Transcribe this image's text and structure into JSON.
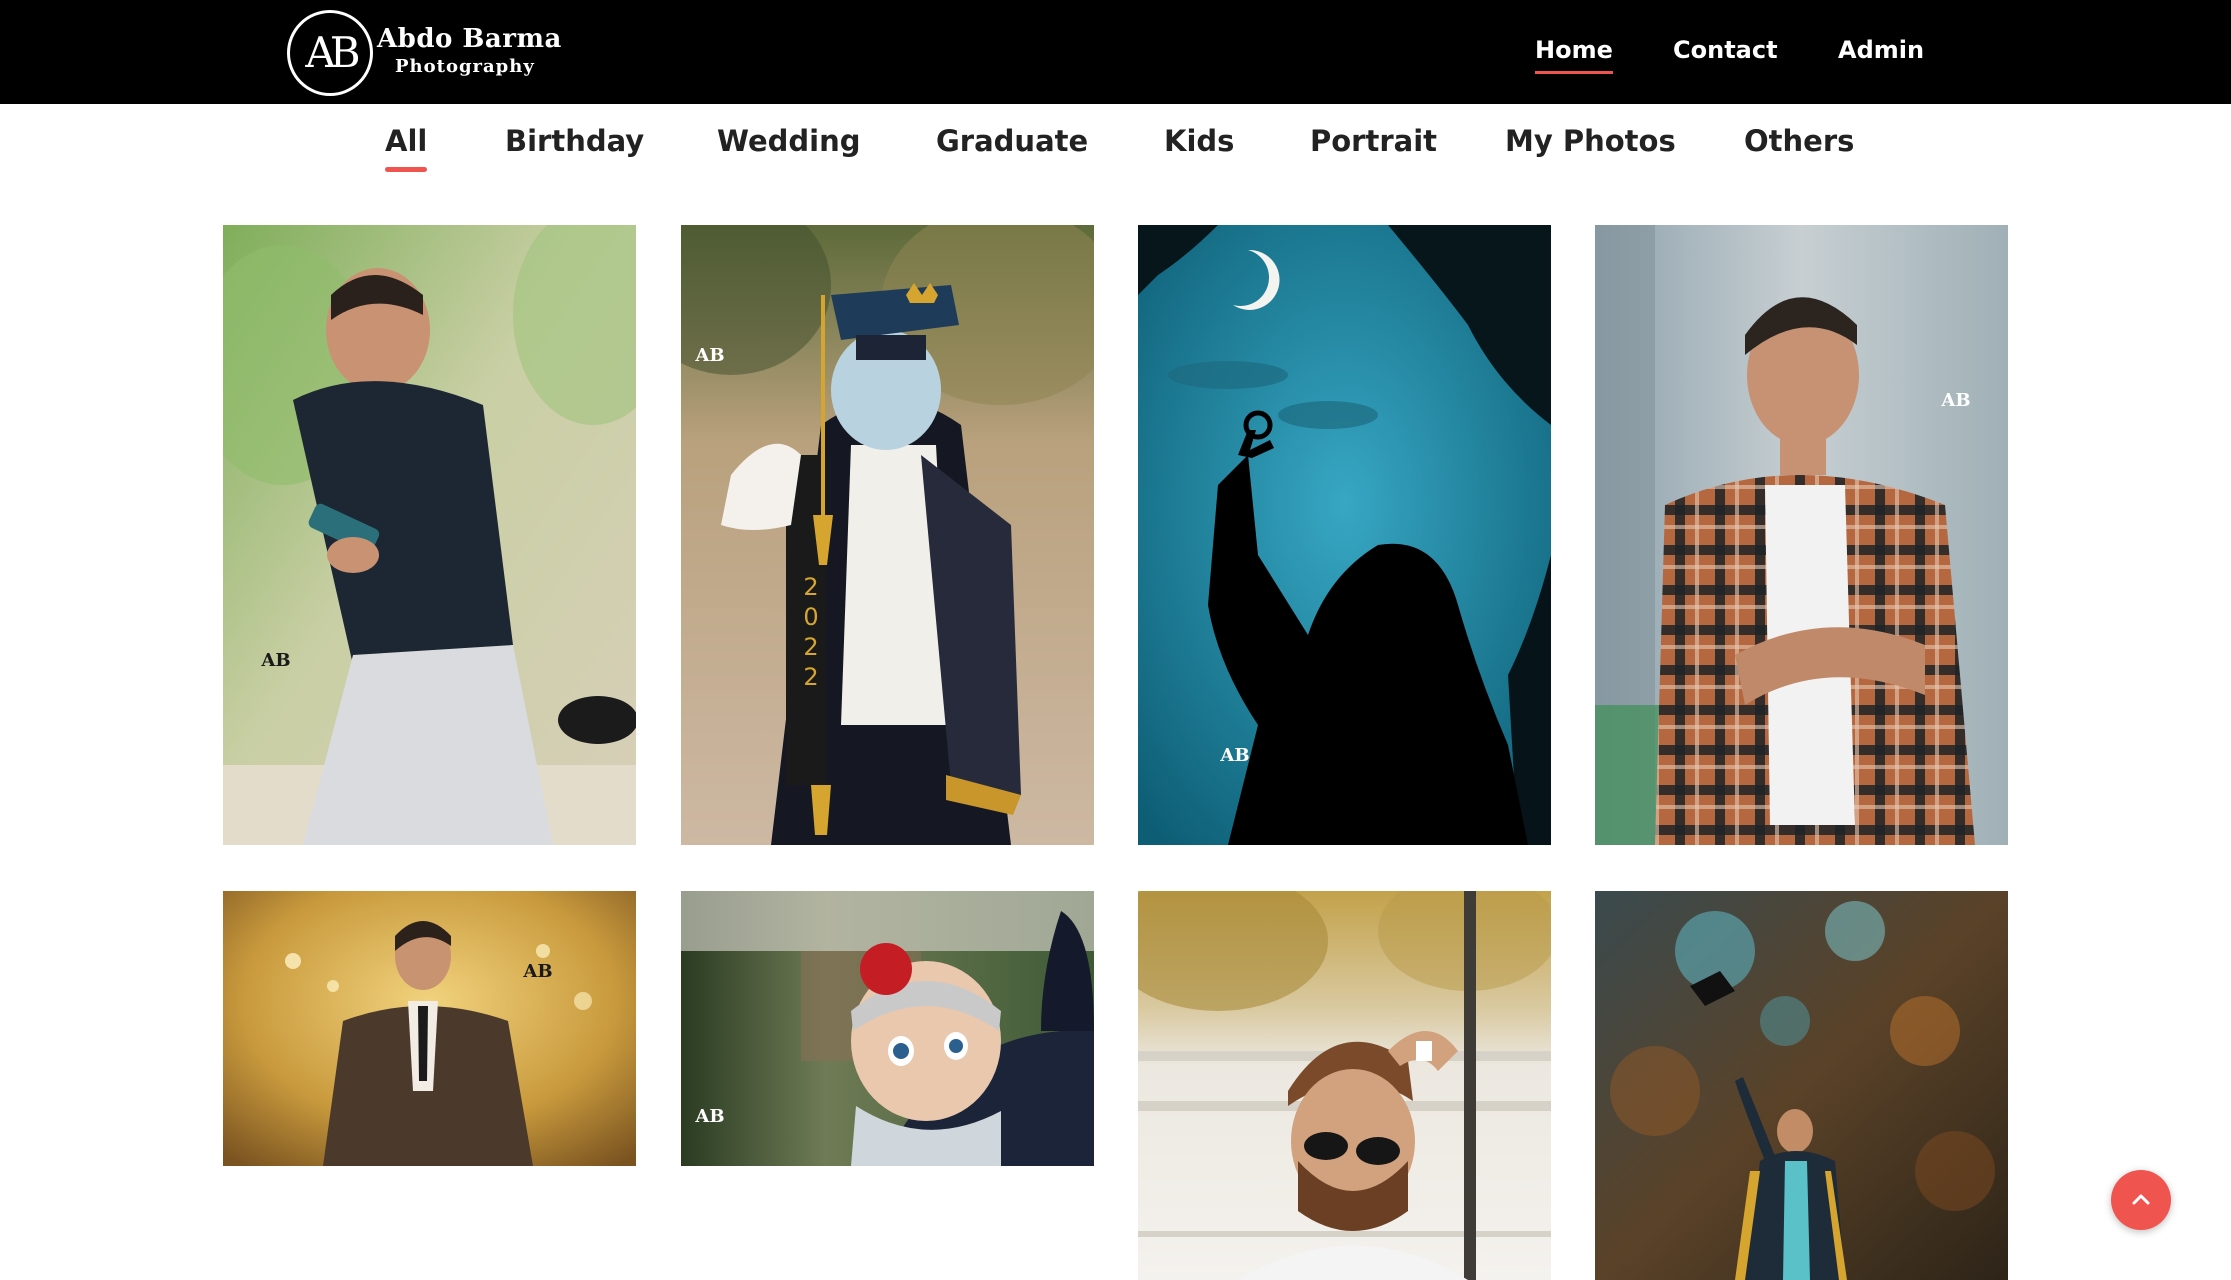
{
  "brand": {
    "monogram": "AB",
    "name": "Abdo Barma",
    "tagline": "Photography"
  },
  "nav": {
    "home": "Home",
    "contact": "Contact",
    "admin": "Admin",
    "active": "Home"
  },
  "filters": {
    "active": "All",
    "items": [
      "All",
      "Birthday",
      "Wedding",
      "Graduate",
      "Kids",
      "Portrait",
      "My Photos",
      "Others"
    ]
  },
  "gallery": {
    "photos": [
      {
        "subject": "man in dark shirt looking at phone",
        "watermark": "AB"
      },
      {
        "subject": "graduate with cap and gown, back view, 2022 stole",
        "watermark": "AB"
      },
      {
        "subject": "silhouette holding key under blue night sky and crescent moon",
        "watermark": "AB"
      },
      {
        "subject": "young man in plaid shirt",
        "watermark": "AB"
      },
      {
        "subject": "man in suit, warm bokeh background",
        "watermark": "AB"
      },
      {
        "subject": "baby with red flower headband",
        "watermark": "AB"
      },
      {
        "subject": "man with sunglasses leaning on pole",
        "watermark": ""
      },
      {
        "subject": "graduate tossing cap among trees",
        "watermark": ""
      }
    ]
  },
  "colors": {
    "topbar": "#000000",
    "accent": "#f0544f",
    "tab_text": "#222222"
  },
  "icons": {
    "back_to_top": "chevron-up-icon"
  }
}
